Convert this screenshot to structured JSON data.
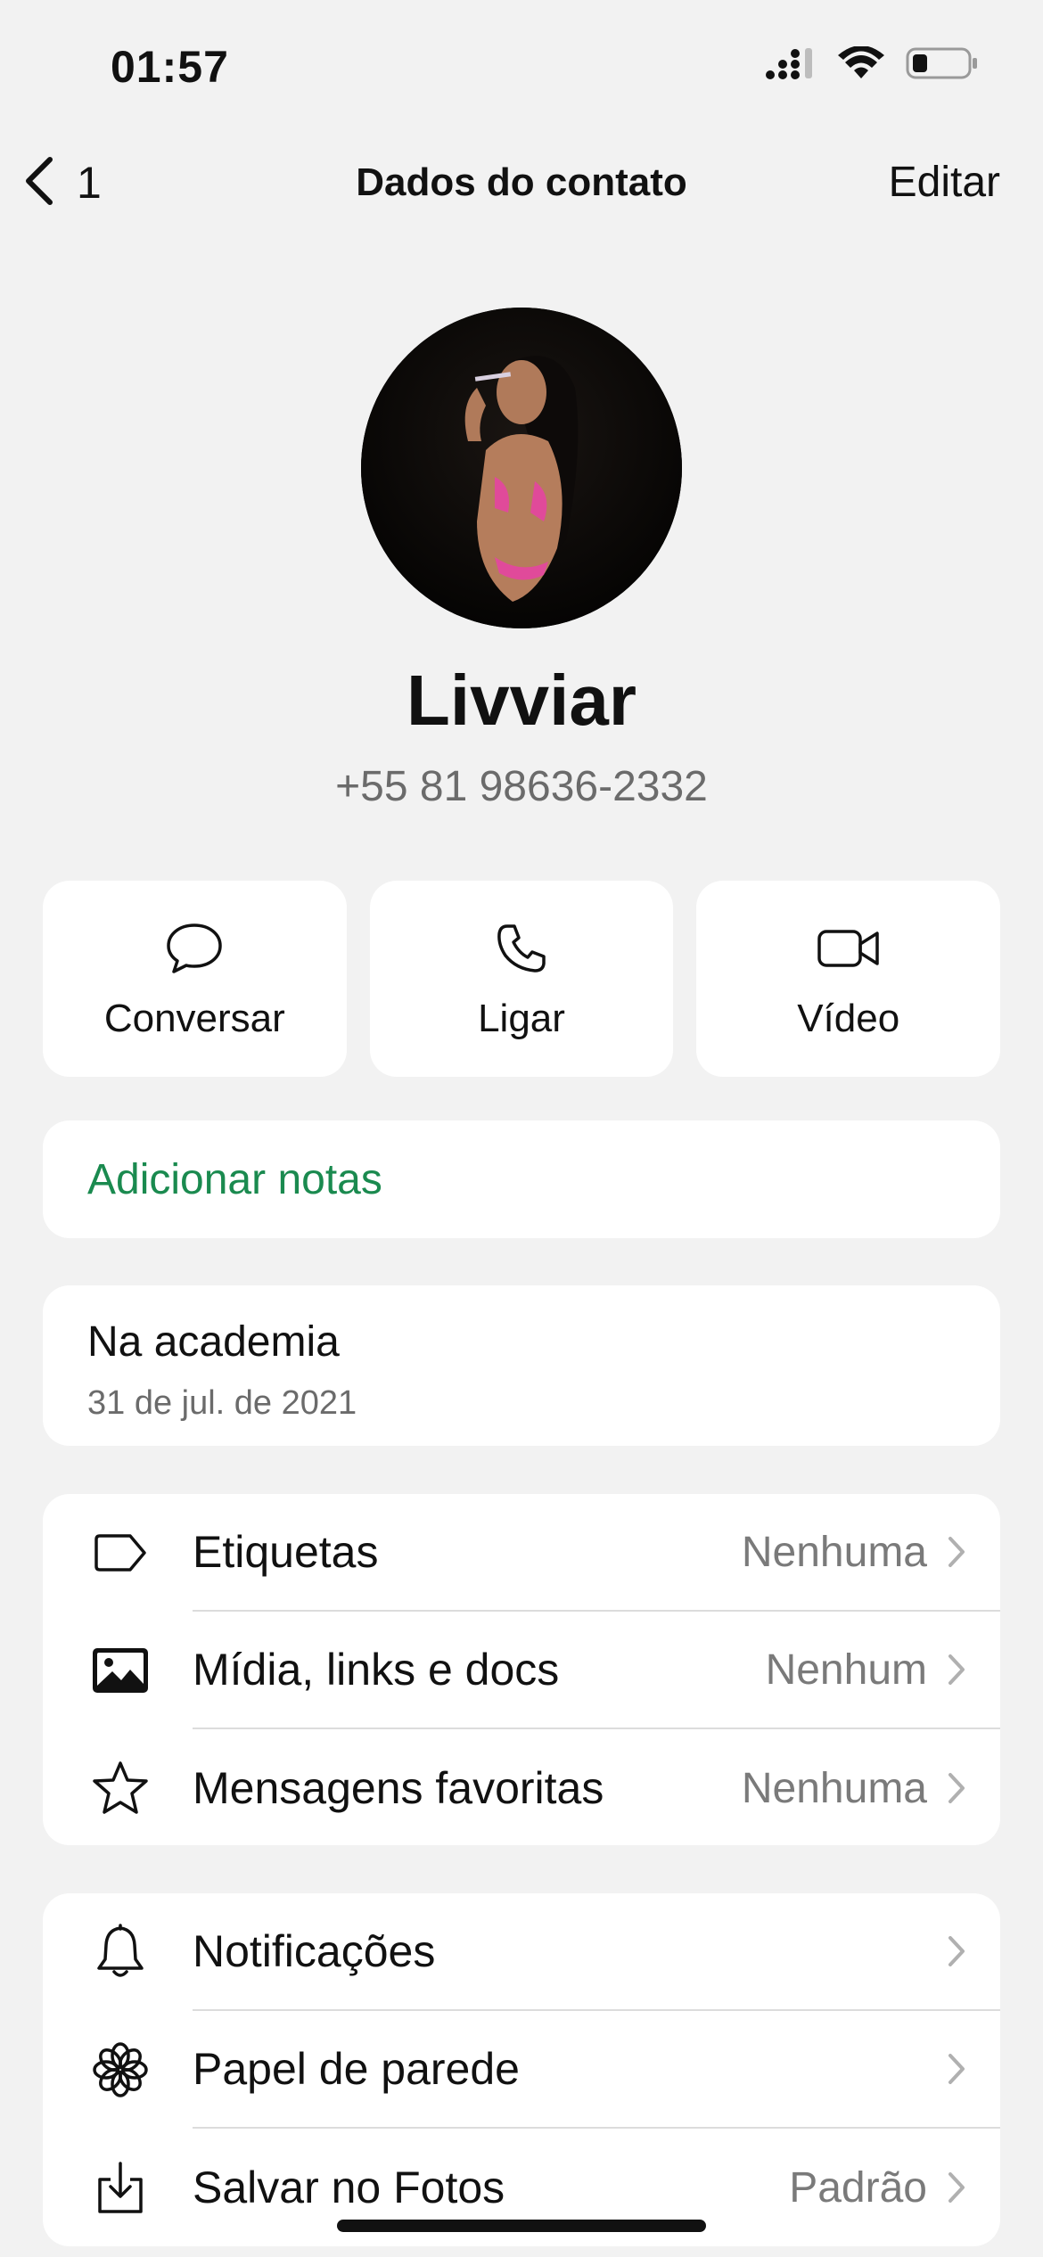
{
  "status_bar": {
    "time": "01:57"
  },
  "nav": {
    "back_count": "1",
    "title": "Dados do contato",
    "edit_label": "Editar"
  },
  "profile": {
    "name": "Livviar",
    "phone": "+55 81 98636-2332"
  },
  "actions": [
    {
      "label": "Conversar",
      "icon": "chat-bubble-icon"
    },
    {
      "label": "Ligar",
      "icon": "phone-icon"
    },
    {
      "label": "Vídeo",
      "icon": "video-camera-icon"
    }
  ],
  "notes": {
    "label": "Adicionar notas"
  },
  "about": {
    "text": "Na academia",
    "date": "31 de jul. de 2021"
  },
  "list_one": [
    {
      "label": "Etiquetas",
      "value": "Nenhuma",
      "icon": "tag-icon"
    },
    {
      "label": "Mídia, links e docs",
      "value": "Nenhum",
      "icon": "image-icon"
    },
    {
      "label": "Mensagens favoritas",
      "value": "Nenhuma",
      "icon": "star-icon"
    }
  ],
  "list_two": [
    {
      "label": "Notificações",
      "value": "",
      "icon": "bell-icon"
    },
    {
      "label": "Papel de parede",
      "value": "",
      "icon": "flower-icon"
    },
    {
      "label": "Salvar no Fotos",
      "value": "Padrão",
      "icon": "save-download-icon"
    }
  ],
  "colors": {
    "background": "#f2f2f2",
    "accent_green": "#1a8a4f",
    "secondary_text": "#6b6b6b"
  }
}
